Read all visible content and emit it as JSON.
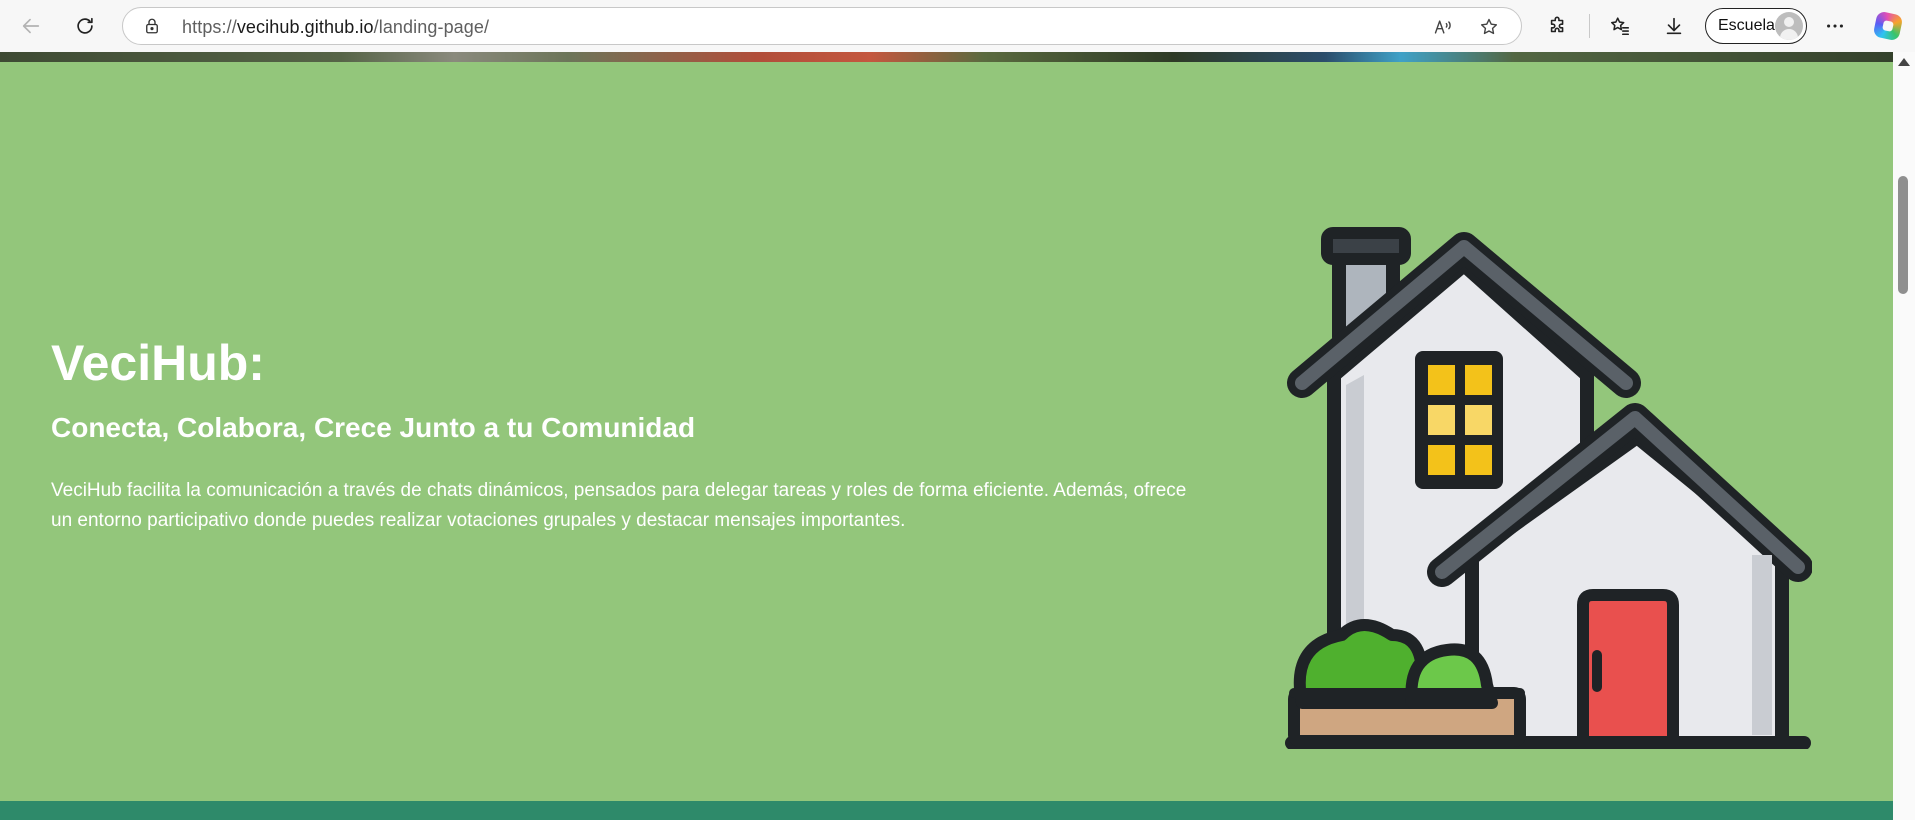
{
  "browser": {
    "url_prefix": "https://",
    "url_host": "vecihub.github.io",
    "url_path": "/landing-page/",
    "profile_name": "Escuela",
    "icons": {
      "back": "back-arrow-icon",
      "refresh": "refresh-icon",
      "lock": "lock-icon",
      "read_aloud": "read-aloud-icon",
      "favorite": "star-icon",
      "extensions": "puzzle-icon",
      "favorites": "favorites-icon",
      "downloads": "download-icon",
      "more": "more-icon",
      "copilot": "copilot-icon"
    }
  },
  "hero": {
    "title": "VeciHub:",
    "subtitle": "Conecta, Colabora, Crece Junto a tu Comunidad",
    "description": "VeciHub facilita la comunicación a través de chats dinámicos, pensados para delegar tareas y roles de forma eficiente. Además, ofrece un entorno participativo donde puedes realizar votaciones grupales y destacar mensajes importantes.",
    "illustration": "house-illustration",
    "colors": {
      "background": "#93c67b",
      "text": "#ffffff",
      "bottom_band": "#2e8a6a",
      "door": "#e9504e",
      "windows": "#f3c21a",
      "bush": "#4fb02e"
    }
  }
}
